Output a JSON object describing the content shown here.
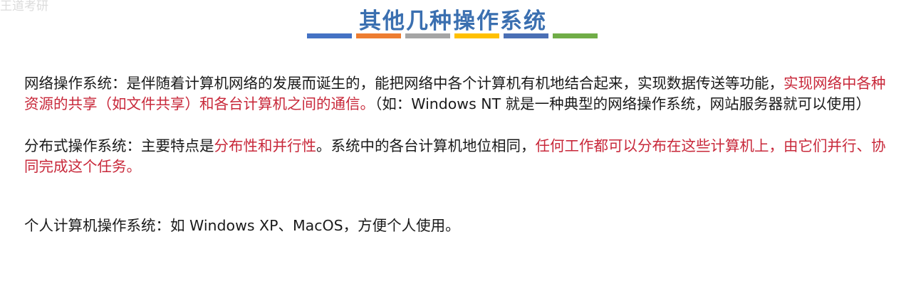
{
  "watermark": "王道考研",
  "title": "其他几种操作系统",
  "title_bar_colors": [
    "#4472c4",
    "#ed7d31",
    "#a5a5a5",
    "#ffc000",
    "#4a6fb5",
    "#70ad47"
  ],
  "highlight_color": "#c8283a",
  "paragraphs": [
    {
      "seg1": "网络操作系统：是伴随着计算机网络的发展而诞生的，能把网络中各个计算机有机地结合起来，实现数据传送等功能，",
      "seg2": "实现网络中各种资源的共享（如文件共享）和各台计算机之间的通信。",
      "seg3": "（如：Windows NT 就是一种典型的网络操作系统，网站服务器就可以使用）"
    },
    {
      "seg1": "分布式操作系统：主要特点是",
      "seg2": "分布性和并行性",
      "seg3": "。系统中的各台计算机地位相同，",
      "seg4": "任何工作都可以分布在这些计算机上，由它们并行、协同完成这个任务。"
    },
    {
      "seg1": "个人计算机操作系统：如 Windows XP、MacOS，方便个人使用。"
    }
  ]
}
